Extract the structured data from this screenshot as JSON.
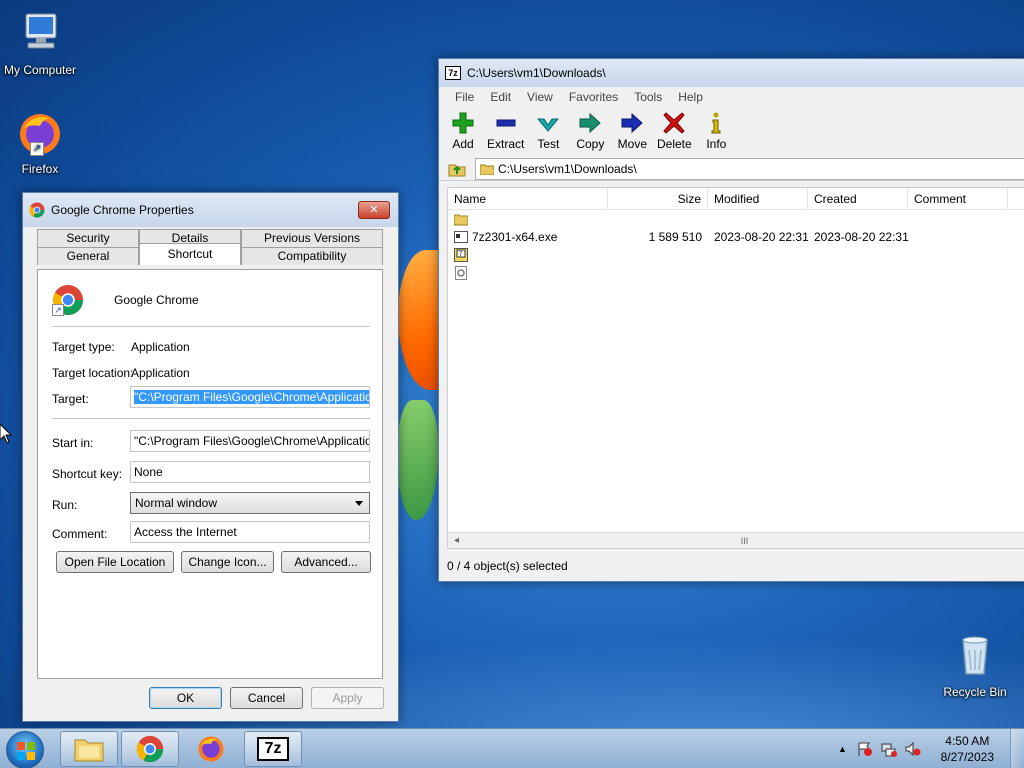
{
  "desktop": {
    "icons": [
      {
        "label": "My Computer"
      },
      {
        "label": "Firefox"
      },
      {
        "label": "Recycle Bin"
      }
    ]
  },
  "sevenzip": {
    "title": "C:\\Users\\vm1\\Downloads\\",
    "logo": "7z",
    "menu": [
      "File",
      "Edit",
      "View",
      "Favorites",
      "Tools",
      "Help"
    ],
    "toolbar": [
      {
        "label": "Add",
        "icon": "plus-icon",
        "color": "#1fa11f"
      },
      {
        "label": "Extract",
        "icon": "minus-icon",
        "color": "#1a2fb0"
      },
      {
        "label": "Test",
        "icon": "check-icon",
        "color": "#1aa7a7"
      },
      {
        "label": "Copy",
        "icon": "copy-arrow-icon",
        "color": "#1a8f6f"
      },
      {
        "label": "Move",
        "icon": "move-arrow-icon",
        "color": "#1a2fb0"
      },
      {
        "label": "Delete",
        "icon": "x-icon",
        "color": "#cc1111"
      },
      {
        "label": "Info",
        "icon": "info-icon",
        "color": "#b8a000"
      }
    ],
    "address": "C:\\Users\\vm1\\Downloads\\",
    "columns": [
      "Name",
      "Size",
      "Modified",
      "Created",
      "Comment"
    ],
    "rows": [
      {
        "name": "",
        "size": "",
        "modified": "",
        "created": "",
        "icon": "folder-icon"
      },
      {
        "name": "7z2301-x64.exe",
        "size": "1 589 510",
        "modified": "2023-08-20 22:31",
        "created": "2023-08-20 22:31",
        "icon": "exe-icon"
      },
      {
        "name": "",
        "size": "",
        "modified": "",
        "created": "",
        "icon": "archive-icon"
      },
      {
        "name": "",
        "size": "",
        "modified": "",
        "created": "",
        "icon": "settings-file-icon"
      }
    ],
    "status": "0 / 4 object(s) selected",
    "scroll_grip": "III"
  },
  "props": {
    "title": "Google Chrome Properties",
    "close": "✕",
    "tabs_top": [
      "Security",
      "Details",
      "Previous Versions"
    ],
    "tabs_bottom": [
      "General",
      "Shortcut",
      "Compatibility"
    ],
    "app_name": "Google Chrome",
    "target_type_label": "Target type:",
    "target_type": "Application",
    "target_location_label": "Target location:",
    "target_location": "Application",
    "target_label": "Target:",
    "target": "\"C:\\Program Files\\Google\\Chrome\\Application\\chrome.exe\"",
    "start_in_label": "Start in:",
    "start_in": "\"C:\\Program Files\\Google\\Chrome\\Application\"",
    "shortcut_key_label": "Shortcut key:",
    "shortcut_key": "None",
    "run_label": "Run:",
    "run": "Normal window",
    "comment_label": "Comment:",
    "comment": "Access the Internet",
    "btn_open_location": "Open File Location",
    "btn_change_icon": "Change Icon...",
    "btn_advanced": "Advanced...",
    "btn_ok": "OK",
    "btn_cancel": "Cancel",
    "btn_apply": "Apply"
  },
  "taskbar": {
    "clock_time": "4:50 AM",
    "clock_date": "8/27/2023",
    "tray_arrow": "▲"
  }
}
